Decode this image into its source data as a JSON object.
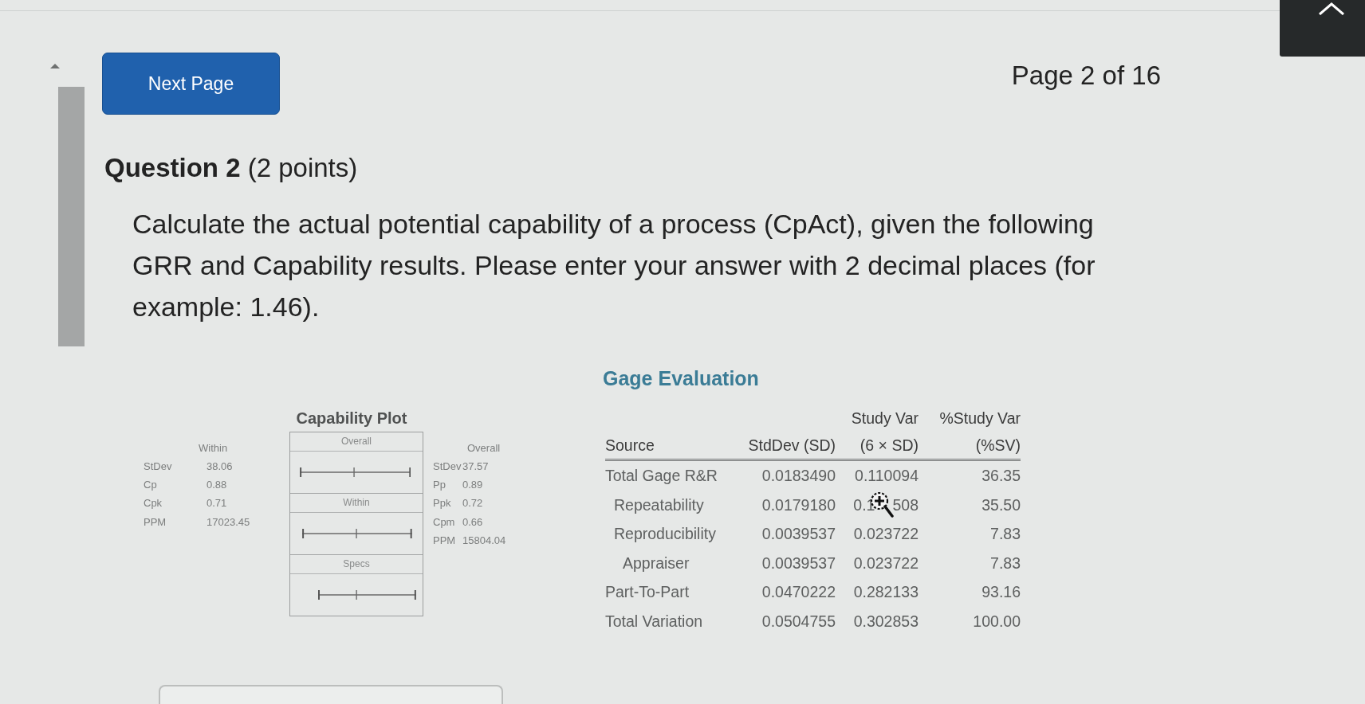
{
  "header": {
    "next_button": "Next Page",
    "page_indicator": "Page 2 of 16"
  },
  "question": {
    "heading": "**Question 2** (2 points)",
    "prompt": "Calculate the actual potential capability of a process (CpAct), given the following GRR and Capability results. Please enter your answer with 2 decimal places (for example: 1.46)."
  },
  "capability": {
    "title": "Capability Plot",
    "within": {
      "label": "Within",
      "stats": [
        {
          "name": "StDev",
          "value": "38.06"
        },
        {
          "name": "Cp",
          "value": "0.88"
        },
        {
          "name": "Cpk",
          "value": "0.71"
        },
        {
          "name": "PPM",
          "value": "17023.45"
        }
      ]
    },
    "panels": [
      {
        "label": "Overall"
      },
      {
        "label": "Within"
      },
      {
        "label": "Specs"
      }
    ],
    "overall": {
      "label": "Overall",
      "stats": [
        {
          "name": "StDev",
          "value": "37.57"
        },
        {
          "name": "Pp",
          "value": "0.89"
        },
        {
          "name": "Ppk",
          "value": "0.72"
        },
        {
          "name": "Cpm",
          "value": "0.66"
        },
        {
          "name": "PPM",
          "value": "15804.04"
        }
      ]
    }
  },
  "gage_evaluation": {
    "title": "Gage Evaluation",
    "columns": [
      {
        "lines": [
          "Source"
        ]
      },
      {
        "lines": [
          "StdDev (SD)"
        ]
      },
      {
        "lines": [
          "Study Var",
          "(6 × SD)"
        ]
      },
      {
        "lines": [
          "%Study Var",
          "(%SV)"
        ]
      }
    ],
    "rows": [
      {
        "source": "Total Gage R&R",
        "values": [
          "0.0183490",
          "0.110094",
          "36.35"
        ],
        "children": [
          {
            "source": "Repeatability",
            "values": [
              "0.0179180",
              {
                "kind": "covered_by_cursor",
                "before": "0.1",
                "after": "508"
              },
              "35.50"
            ]
          },
          {
            "source": "Reproducibility",
            "values": [
              "0.0039537",
              "0.023722",
              "7.83"
            ],
            "children": [
              {
                "source": "Appraiser",
                "values": [
                  "0.0039537",
                  "0.023722",
                  "7.83"
                ]
              }
            ]
          }
        ]
      },
      {
        "source": "Part-To-Part",
        "values": [
          "0.0470222",
          "0.282133",
          "93.16"
        ]
      },
      {
        "source": "Total Variation",
        "values": [
          "0.0504755",
          "0.302853",
          "100.00"
        ]
      }
    ]
  }
}
